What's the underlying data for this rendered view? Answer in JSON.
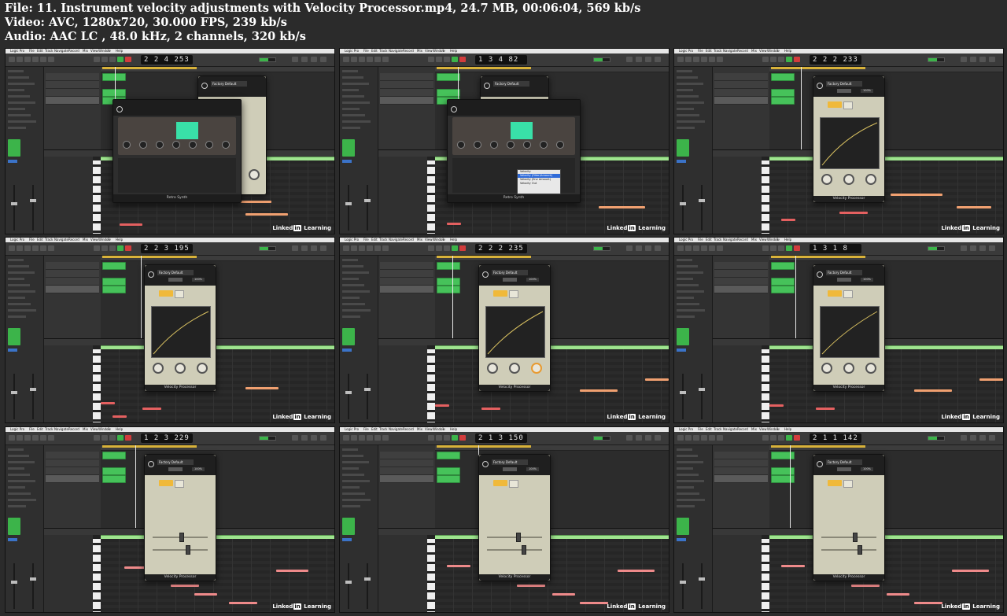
{
  "header": {
    "file_line": "File: 11. Instrument velocity adjustments with Velocity Processor.mp4, 24.7 MB, 00:06:04, 569 kb/s",
    "video_line": "Video: AVC, 1280x720, 30.000 FPS, 239 kb/s",
    "audio_line": "Audio: AAC LC , 48.0 kHz, 2 channels, 320 kb/s"
  },
  "menubar": [
    "Logic Pro",
    "File",
    "Edit",
    "Track",
    "Navigate",
    "Record",
    "Mix",
    "View",
    "Window",
    "?",
    "Help"
  ],
  "watermark": {
    "brand_left": "Linked",
    "brand_in": "in",
    "brand_right": " Learning"
  },
  "plugin_footer": "Velocity Processor",
  "synth_footer": "Retro Synth",
  "preset": "Factory Default",
  "compare": "Compare",
  "pct": "100%",
  "dropdown_items": [
    "Velocity",
    "Velocity (Filter/Amount)",
    "Velocity (Env Amount)",
    "Velocity Out"
  ],
  "frames": [
    {
      "lcd": "2 2 4 253",
      "view": "synth"
    },
    {
      "lcd": "1 3 4 82",
      "view": "synth-menu"
    },
    {
      "lcd": "2 2 2 233",
      "view": "curve"
    },
    {
      "lcd": "2 2 3 195",
      "view": "curve"
    },
    {
      "lcd": "2 2 2 235",
      "view": "curve-orange"
    },
    {
      "lcd": "1 3 1 8",
      "view": "curve"
    },
    {
      "lcd": "1 2 3 229",
      "view": "sliders"
    },
    {
      "lcd": "2 1 3 150",
      "view": "sliders"
    },
    {
      "lcd": "2 1 1 142",
      "view": "sliders"
    }
  ]
}
